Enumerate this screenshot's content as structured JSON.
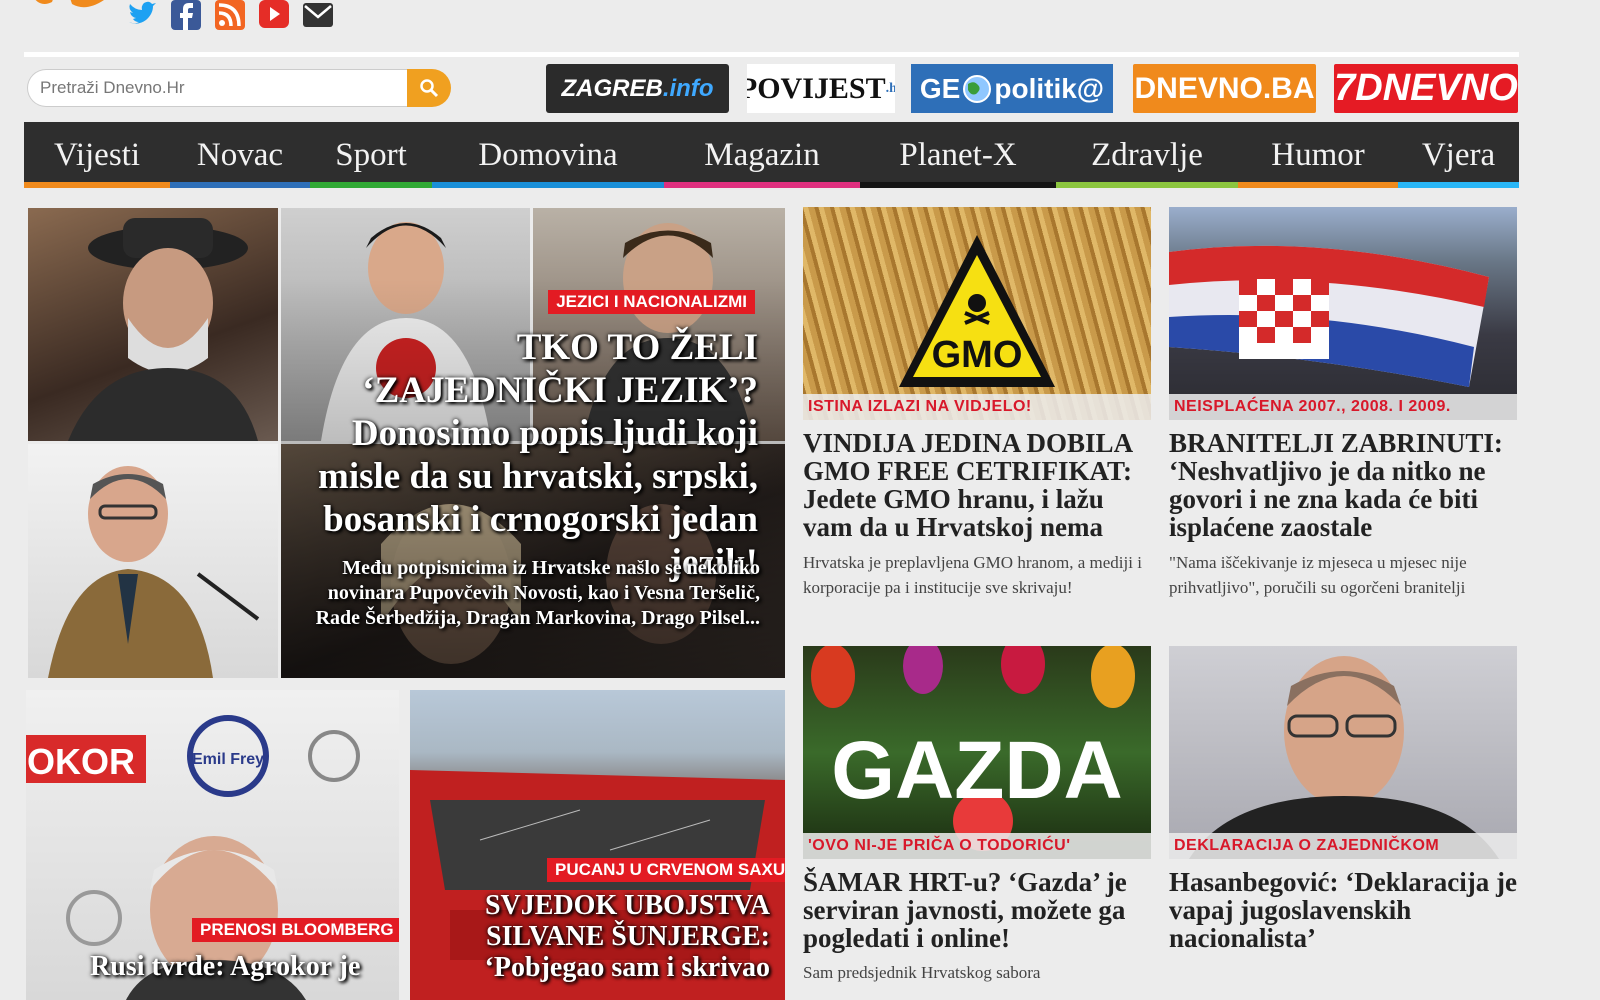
{
  "search": {
    "placeholder": "Pretraži Dnevno.Hr"
  },
  "social": [
    "twitter-icon",
    "facebook-icon",
    "rss-icon",
    "youtube-icon",
    "mail-icon"
  ],
  "partners": {
    "zagreb_a": "ZAGREB",
    "zagreb_b": ".info",
    "povijest_a": "POVIJEST",
    "povijest_b": ".hr",
    "geopolitika_a": "GE",
    "geopolitika_b": "politik@",
    "dnevno_ba": "DNEVNO.BA",
    "sedam_dnevno": "7DNEVNO"
  },
  "nav": [
    {
      "label": "Vijesti",
      "color": "#f08a1c"
    },
    {
      "label": "Novac",
      "color": "#2e6fb8"
    },
    {
      "label": "Sport",
      "color": "#31a935"
    },
    {
      "label": "Domovina",
      "color": "#1a8fd8"
    },
    {
      "label": "Magazin",
      "color": "#e0307f"
    },
    {
      "label": "Planet-X",
      "color": "#151515"
    },
    {
      "label": "Zdravlje",
      "color": "#8cc63f"
    },
    {
      "label": "Humor",
      "color": "#f08a1c"
    },
    {
      "label": "Vjera",
      "color": "#29b6f6"
    }
  ],
  "hero": {
    "tag": "JEZICI I NACIONALIZMI",
    "title": "TKO TO ŽELI ‘ZAJEDNIČKI JEZIK’? Donosimo popis ljudi koji misle da su hrvatski, srpski, bosanski i crnogorski jedan jezik!",
    "excerpt": "Među potpisnicima iz Hrvatske našlo se nekoliko novinara Pupovčevih Novosti, kao i Vesna Teršelič, Rade Šerbedžija, Dragan Markovina, Drago Pilsel..."
  },
  "card_gmo": {
    "image_text": "GMO",
    "label": "ISTINA IZLAZI NA VIDJELO!",
    "title": "VINDIJA JEDINA DOBILA GMO FREE CETRIFIKAT: Jedete GMO hranu, i lažu vam da u Hrvatskoj nema",
    "excerpt": "Hrvatska je preplavljena GMO hranom, a mediji i korporacije pa i institucije sve skrivaju!"
  },
  "card_branitelji": {
    "label": "NEISPLAĆENA 2007., 2008. I 2009.",
    "title": "BRANITELJI ZABRINUTI: ‘Neshvatljivo je da nitko ne govori i ne zna kada će biti isplaćene zaostale",
    "excerpt": "\"Nama iščekivanje iz mjeseca u mjesec nije prihvatljivo\", poručili su ogorčeni branitelji"
  },
  "card_gazda": {
    "image_text": "GAZDA",
    "label": "'OVO NI-JE PRIČA O TODORIĆU'",
    "title": "ŠAMAR HRT-u? ‘Gazda’ je serviran javnosti, možete ga pogledati i online!",
    "excerpt": "Sam predsjednik Hrvatskog sabora"
  },
  "card_hasan": {
    "label": "DEKLARACIJA O ZAJEDNIČKOM",
    "title": "Hasanbegović: ‘Deklaracija je vapaj jugoslavenskih nacionalista’"
  },
  "card_agrokor": {
    "sign_text": "OKOR",
    "sign_brand": "Emil Frey",
    "tag": "PRENOSI BLOOMBERG",
    "title": "Rusi tvrde: Agrokor je"
  },
  "card_saxo": {
    "tag": "PUCANJ U CRVENOM SAXU",
    "title": "SVJEDOK UBOJSTVA SILVANE ŠUNJERGE: ‘Pobjegao sam i skrivao"
  }
}
